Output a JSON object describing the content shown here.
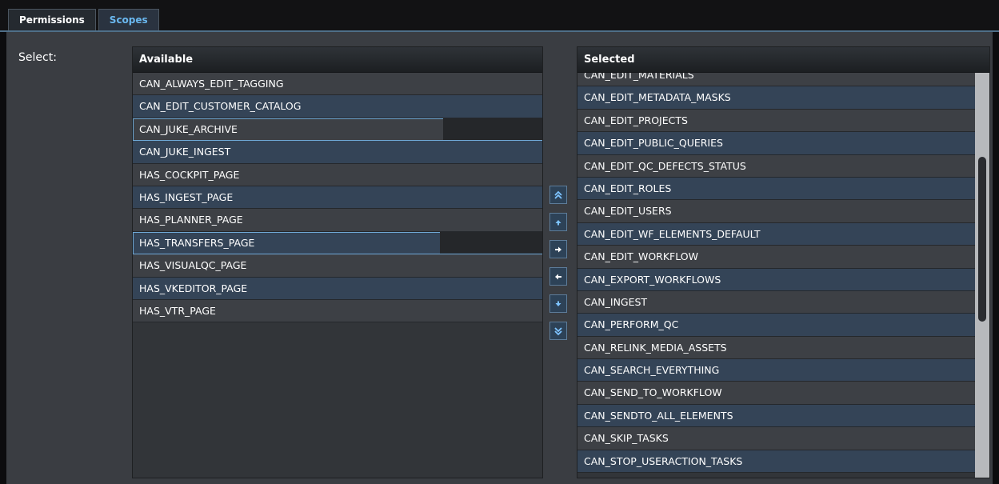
{
  "tabs": [
    {
      "label": "Permissions",
      "active": false
    },
    {
      "label": "Scopes",
      "active": true
    }
  ],
  "select_label": "Select:",
  "available": {
    "header": "Available",
    "items": [
      "CAN_ALWAYS_EDIT_TAGGING",
      "CAN_EDIT_CUSTOMER_CATALOG",
      "CAN_JUKE_ARCHIVE",
      "CAN_JUKE_INGEST",
      "HAS_COCKPIT_PAGE",
      "HAS_INGEST_PAGE",
      "HAS_PLANNER_PAGE",
      "HAS_TRANSFERS_PAGE",
      "HAS_VISUALQC_PAGE",
      "HAS_VKEDITOR_PAGE",
      "HAS_VTR_PAGE"
    ]
  },
  "selected": {
    "header": "Selected",
    "items": [
      "CAN_EDIT_MATERIALS",
      "CAN_EDIT_METADATA_MASKS",
      "CAN_EDIT_PROJECTS",
      "CAN_EDIT_PUBLIC_QUERIES",
      "CAN_EDIT_QC_DEFECTS_STATUS",
      "CAN_EDIT_ROLES",
      "CAN_EDIT_USERS",
      "CAN_EDIT_WF_ELEMENTS_DEFAULT",
      "CAN_EDIT_WORKFLOW",
      "CAN_EXPORT_WORKFLOWS",
      "CAN_INGEST",
      "CAN_PERFORM_QC",
      "CAN_RELINK_MEDIA_ASSETS",
      "CAN_SEARCH_EVERYTHING",
      "CAN_SEND_TO_WORKFLOW",
      "CAN_SENDTO_ALL_ELEMENTS",
      "CAN_SKIP_TASKS",
      "CAN_STOP_USERACTION_TASKS"
    ]
  },
  "move_buttons": [
    {
      "name": "move-top-button",
      "icon": "double-arrow-up-icon"
    },
    {
      "name": "move-up-button",
      "icon": "arrow-up-icon"
    },
    {
      "name": "add-to-selected-button",
      "icon": "arrow-right-icon"
    },
    {
      "name": "remove-from-selected-button",
      "icon": "arrow-left-icon"
    },
    {
      "name": "move-down-button",
      "icon": "arrow-down-icon"
    },
    {
      "name": "move-bottom-button",
      "icon": "double-arrow-down-icon"
    }
  ],
  "colors": {
    "active_tab_text": "#6ab8f0",
    "row_alt": "#344457",
    "row_base": "#3d4045",
    "button_bg": "#2d4257"
  }
}
